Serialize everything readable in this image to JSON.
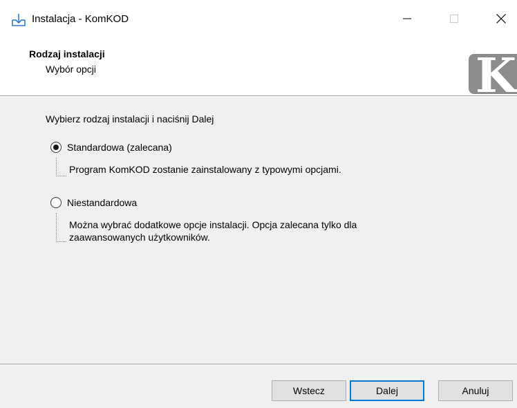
{
  "window": {
    "title": "Instalacja - KomKOD"
  },
  "header": {
    "title": "Rodzaj instalacji",
    "subtitle": "Wybór opcji",
    "logo_letter": "K"
  },
  "content": {
    "instruction": "Wybierz rodzaj instalacji i naciśnij Dalej",
    "options": [
      {
        "label": "Standardowa (zalecana)",
        "description": "Program KomKOD zostanie zainstalowany z typowymi opcjami.",
        "selected": true
      },
      {
        "label": "Niestandardowa",
        "description": "Można wybrać dodatkowe opcje instalacji. Opcja zalecana tylko dla zaawansowanych użytkowników.",
        "selected": false
      }
    ]
  },
  "buttons": {
    "back": "Wstecz",
    "next": "Dalej",
    "cancel": "Anuluj"
  },
  "icons": {
    "app": "install-download-icon",
    "minimize": "minimize-icon",
    "maximize": "maximize-icon",
    "close": "close-icon"
  },
  "colors": {
    "accent": "#0078d7",
    "logo_bg": "#8c8c8c"
  }
}
